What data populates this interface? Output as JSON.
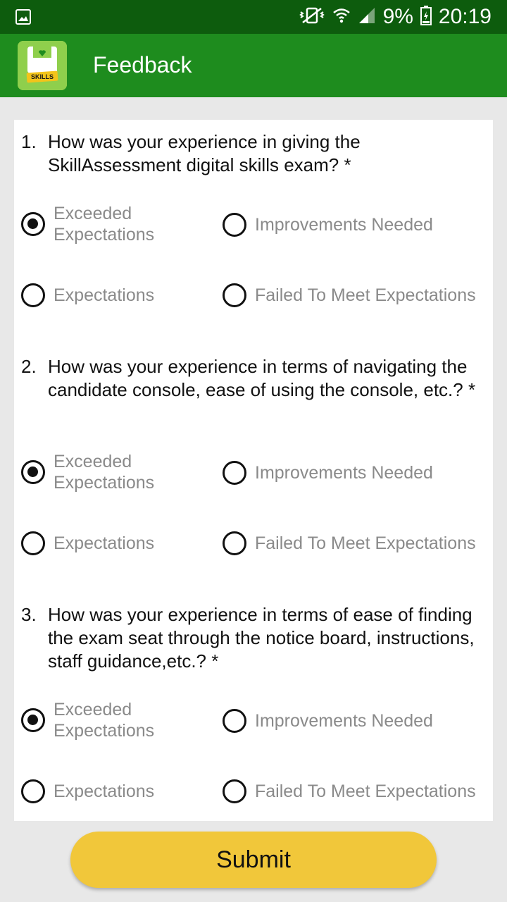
{
  "status_bar": {
    "battery_percent": "9%",
    "time": "20:19",
    "icons": [
      "gallery-icon",
      "mute-vibrate-icon",
      "wifi-icon",
      "signal-icon",
      "battery-icon"
    ]
  },
  "app_bar": {
    "title": "Feedback",
    "logo_text": "SKILLS"
  },
  "questions": [
    {
      "number": "1.",
      "text": "How was your experience in giving the SkillAssessment digital skills exam? *",
      "options": [
        "Exceeded Expectations",
        "Improvements Needed",
        "Expectations",
        "Failed To Meet Expectations"
      ],
      "selected": "Exceeded Expectations"
    },
    {
      "number": "2.",
      "text": "How was your experience in terms of navigating the candidate console, ease of using the console, etc.? *",
      "options": [
        "Exceeded Expectations",
        "Improvements Needed",
        "Expectations",
        "Failed To Meet Expectations"
      ],
      "selected": "Exceeded Expectations"
    },
    {
      "number": "3.",
      "text": "How was your experience in terms of ease of finding the exam seat through the notice board, instructions, staff guidance,etc.? *",
      "options": [
        "Exceeded Expectations",
        "Improvements Needed",
        "Expectations",
        "Failed To Meet Expectations"
      ],
      "selected": "Exceeded Expectations"
    }
  ],
  "submit_label": "Submit",
  "colors": {
    "status_bar": "#0d5c0d",
    "app_bar": "#1e8c1e",
    "submit_button": "#f1c73a",
    "option_text": "#8a8a8a"
  }
}
